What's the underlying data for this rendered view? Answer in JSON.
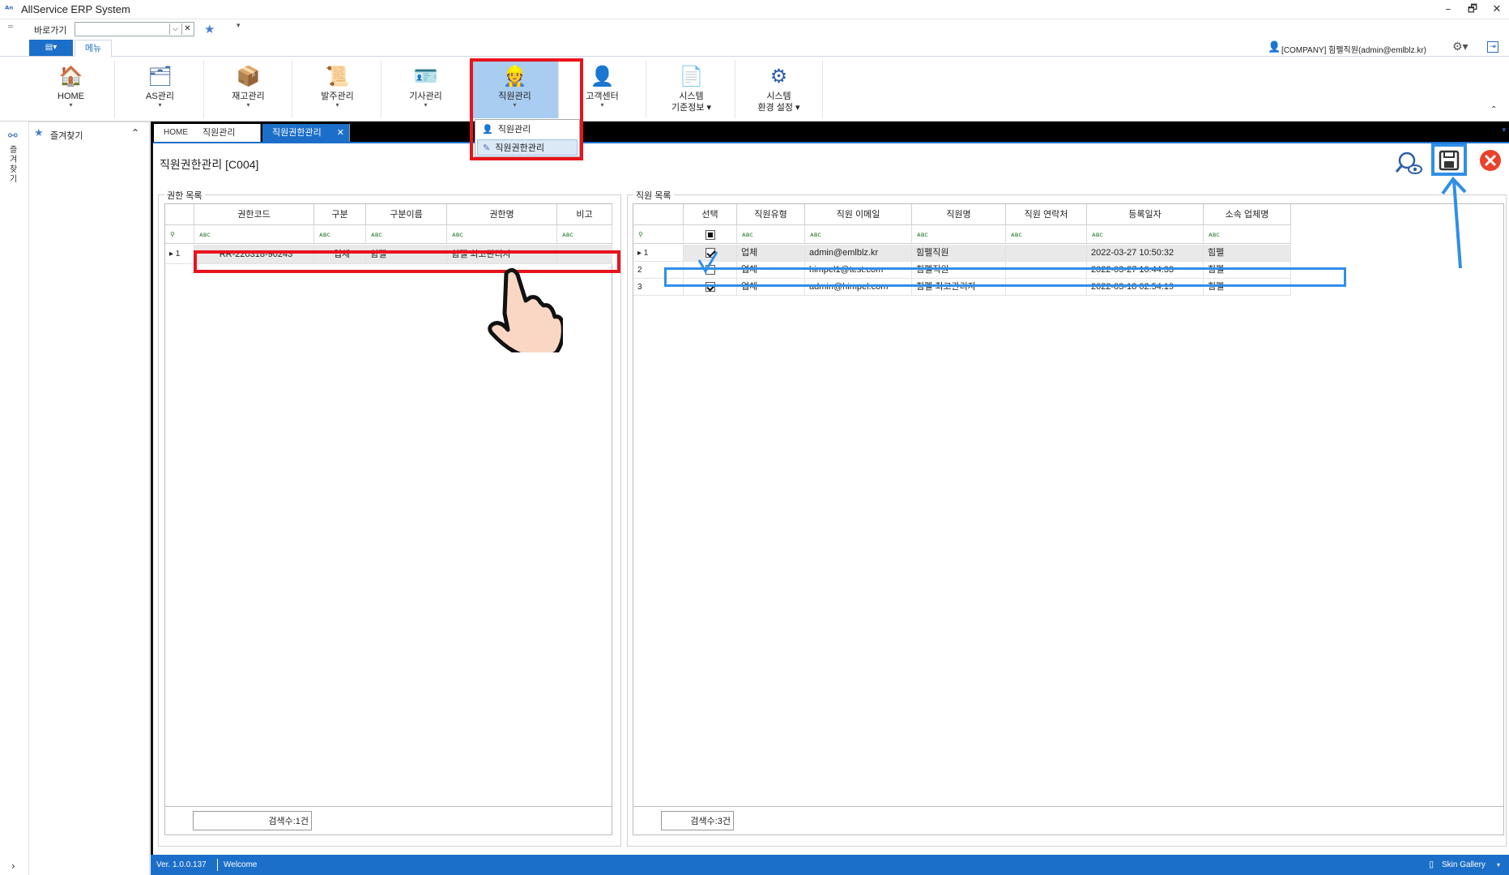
{
  "window": {
    "title": "AllService ERP System",
    "logo": "ᴬⁿ",
    "minimize": "–",
    "restore": "🗗",
    "close": "✕"
  },
  "quickbar": {
    "label": "바로가기"
  },
  "menu_tabs": {
    "view_btn": "▤▾",
    "menu_tab": "메뉴"
  },
  "user": {
    "text": "[COMPANY] 힘펠직원(admin@emlblz.kr)"
  },
  "ribbon": [
    {
      "key": "home",
      "label": "HOME",
      "label2": "",
      "icon": "home-icon"
    },
    {
      "key": "as",
      "label": "AS관리",
      "label2": "",
      "icon": "as-management-icon"
    },
    {
      "key": "stock",
      "label": "재고관리",
      "label2": "",
      "icon": "inventory-icon"
    },
    {
      "key": "order",
      "label": "발주관리",
      "label2": "",
      "icon": "order-icon"
    },
    {
      "key": "tech",
      "label": "기사관리",
      "label2": "",
      "icon": "technician-icon"
    },
    {
      "key": "staff",
      "label": "직원관리",
      "label2": "",
      "icon": "staff-icon"
    },
    {
      "key": "customer",
      "label": "고객센터",
      "label2": "",
      "icon": "customer-center-icon"
    },
    {
      "key": "sysbase",
      "label": "시스템",
      "label2": "기준정보 ▾",
      "icon": "system-base-icon"
    },
    {
      "key": "sysenv",
      "label": "시스템",
      "label2": "환경 설정 ▾",
      "icon": "system-settings-icon"
    }
  ],
  "dropdown": {
    "items": [
      "직원관리",
      "직원권한관리"
    ]
  },
  "sidebar": {
    "favorites": "즐겨찾기",
    "vertical": "즐겨찾기"
  },
  "doc_tabs": [
    "HOME",
    "직원관리",
    "직원권한관리"
  ],
  "page": {
    "title": "직원권한관리 [C004]"
  },
  "left_panel": {
    "title": "권한 목록",
    "columns": [
      "권한코드",
      "구분",
      "구분이름",
      "권한명",
      "비고"
    ],
    "filter_icon": "ᴀʙc",
    "rows": [
      {
        "num": "1",
        "code": "RR-220318-90243",
        "type": "업체",
        "type_name": "힘펠",
        "name": "힘펠 최고관리자",
        "note": ""
      }
    ],
    "count": "검색수:1건"
  },
  "right_panel": {
    "title": "직원 목록",
    "columns": [
      "선택",
      "직원유형",
      "직원 이메일",
      "직원명",
      "직원 연락처",
      "등록일자",
      "소속 업체명"
    ],
    "filter_icon": "ᴀʙc",
    "rows": [
      {
        "num": "1",
        "checked": true,
        "type": "업체",
        "email": "admin@emlblz.kr",
        "name": "힘펠직원",
        "phone": "",
        "date": "2022-03-27 10:50:32",
        "company": "힘펠"
      },
      {
        "num": "2",
        "checked": false,
        "type": "업체",
        "email": "himpel1@test.com",
        "name": "힘펠직원",
        "phone": "",
        "date": "2022-03-27 10:44:33",
        "company": "힘펠"
      },
      {
        "num": "3",
        "checked": true,
        "type": "업체",
        "email": "admin@himpel.com",
        "name": "힘펠 최고관리자",
        "phone": "",
        "date": "2022-03-18 02:54:19",
        "company": "힘펠"
      }
    ],
    "count": "검색수:3건"
  },
  "status": {
    "version": "Ver. 1.0.0.137",
    "welcome": "Welcome",
    "skin": "Skin Gallery"
  },
  "colors": {
    "accent": "#1c6fc9",
    "highlight_red": "#e8141c",
    "highlight_blue": "#2f8fe8"
  }
}
